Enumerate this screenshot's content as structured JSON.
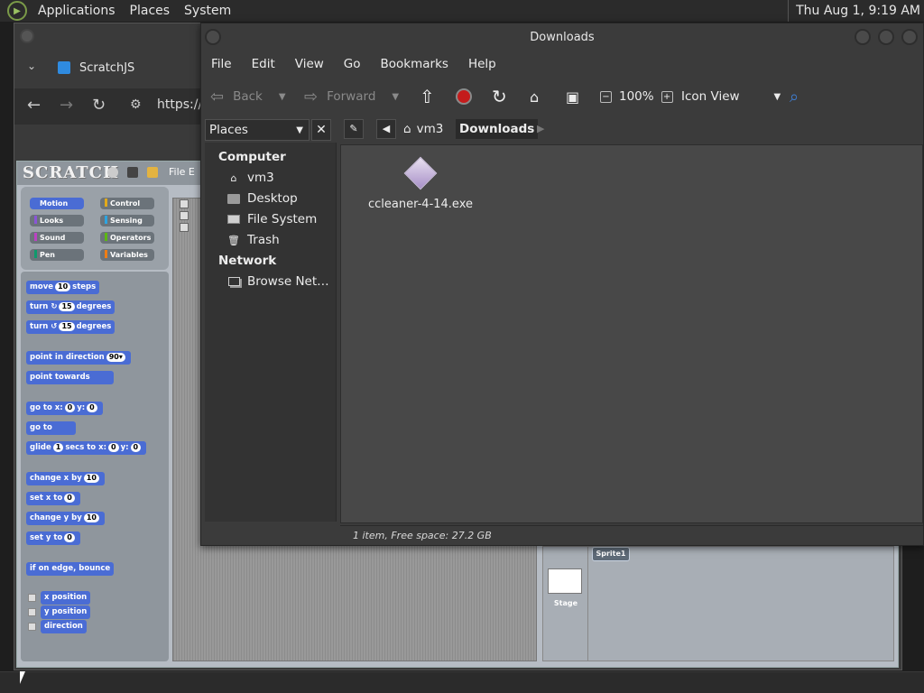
{
  "top_panel": {
    "menus": [
      "Applications",
      "Places",
      "System"
    ],
    "clock": "Thu Aug  1,  9:19 AM"
  },
  "browser": {
    "tab_title": "ScratchJS",
    "url": "https://s"
  },
  "scratch": {
    "logo": "SCRATCH",
    "file_menu": "File  E",
    "categories": [
      {
        "label": "Motion",
        "color": "#4a6cd4"
      },
      {
        "label": "Control",
        "color": "#e1a91a"
      },
      {
        "label": "Looks",
        "color": "#8a55d7"
      },
      {
        "label": "Sensing",
        "color": "#2ca5e2"
      },
      {
        "label": "Sound",
        "color": "#bb42c3"
      },
      {
        "label": "Operators",
        "color": "#5cb712"
      },
      {
        "label": "Pen",
        "color": "#0e9a6c"
      },
      {
        "label": "Variables",
        "color": "#ee7d16"
      }
    ],
    "blocks": {
      "move": [
        "move",
        "10",
        "steps"
      ],
      "turn_cw": [
        "turn ↻",
        "15",
        "degrees"
      ],
      "turn_ccw": [
        "turn ↺",
        "15",
        "degrees"
      ],
      "point_dir": [
        "point in direction",
        "90▾"
      ],
      "point_towards": "point towards",
      "goto_xy": [
        "go to x:",
        "0",
        "y:",
        "0"
      ],
      "goto": "go to",
      "glide": [
        "glide",
        "1",
        "secs to x:",
        "0",
        "y:",
        "0"
      ],
      "change_x": [
        "change x by",
        "10"
      ],
      "set_x": [
        "set x to",
        "0"
      ],
      "change_y": [
        "change y by",
        "10"
      ],
      "set_y": [
        "set y to",
        "0"
      ],
      "bounce": "if on edge, bounce",
      "x_position": "x position",
      "y_position": "y position",
      "direction": "direction"
    },
    "stage_label": "Stage",
    "sprite_label": "Sprite1"
  },
  "file_manager": {
    "title": "Downloads",
    "menus": [
      "File",
      "Edit",
      "View",
      "Go",
      "Bookmarks",
      "Help"
    ],
    "toolbar": {
      "back": "Back",
      "forward": "Forward",
      "zoom": "100%",
      "view_mode": "Icon View"
    },
    "sidebar_title": "Places",
    "sidebar": {
      "computer_label": "Computer",
      "network_label": "Network",
      "computer_items": [
        {
          "label": "vm3",
          "icon": "home-folder-icon"
        },
        {
          "label": "Desktop",
          "icon": "folder-icon"
        },
        {
          "label": "File System",
          "icon": "drive-icon"
        },
        {
          "label": "Trash",
          "icon": "trash-icon"
        }
      ],
      "network_items": [
        {
          "label": "Browse Net…",
          "icon": "network-icon"
        }
      ]
    },
    "path": {
      "parent": "vm3",
      "current": "Downloads"
    },
    "files": [
      {
        "name": "ccleaner-4-14.exe",
        "icon": "executable-icon"
      }
    ],
    "status": "1 item, Free space: 27.2 GB"
  }
}
